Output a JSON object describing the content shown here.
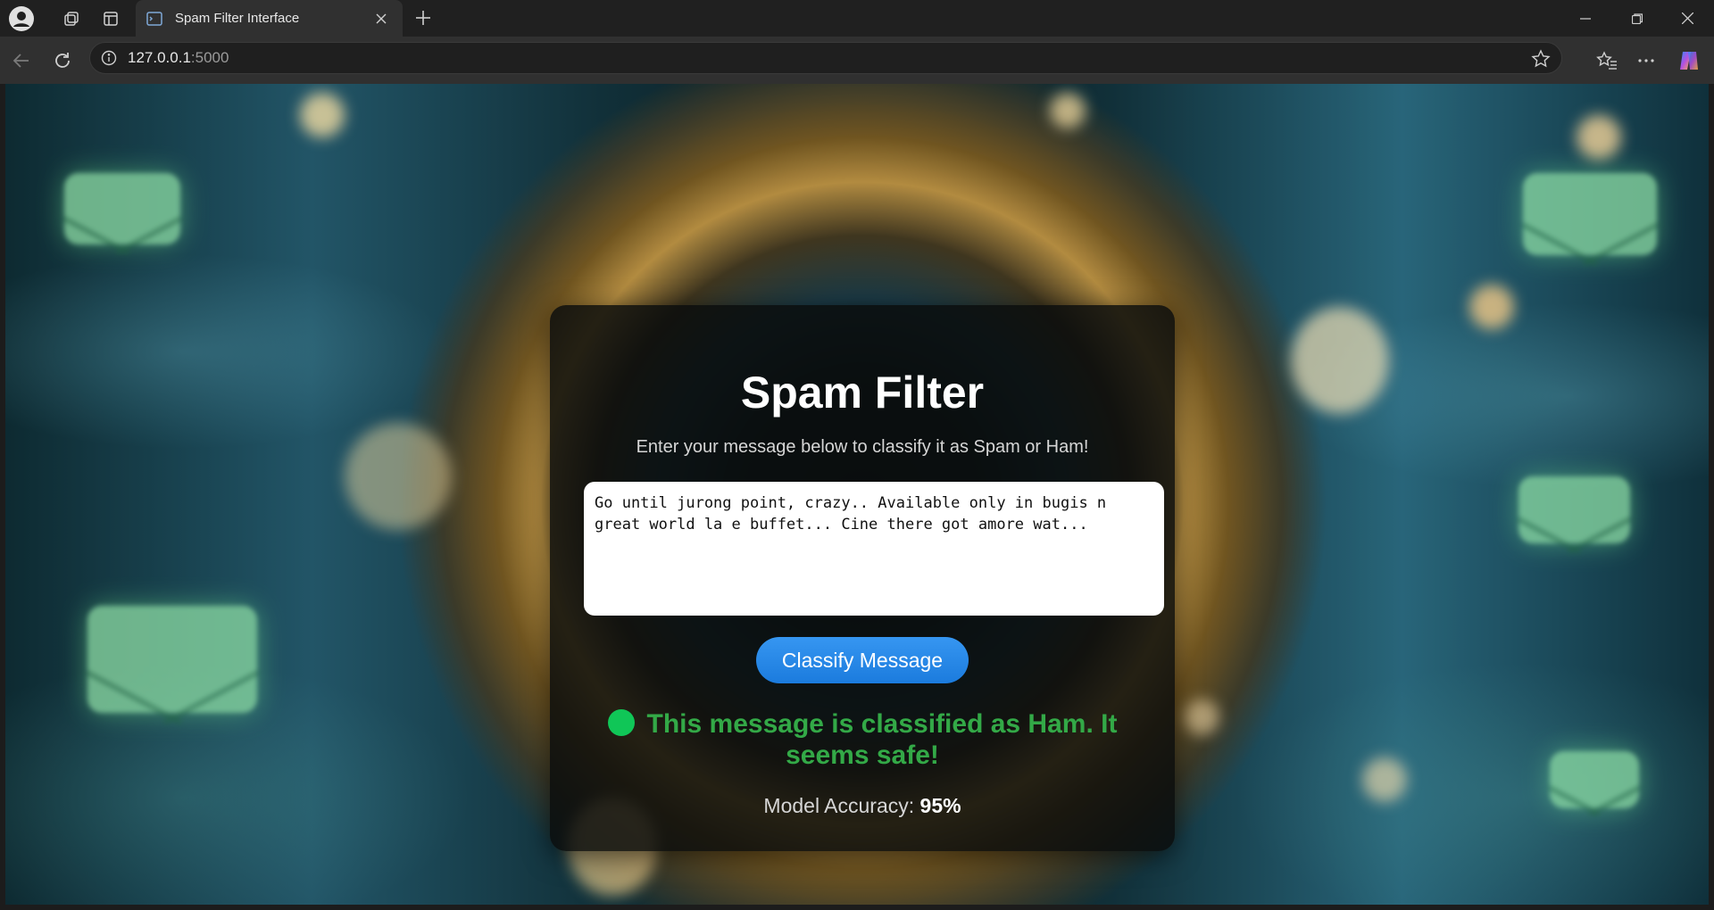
{
  "browser": {
    "tab_title": "Spam Filter Interface",
    "url_host": "127.0.0.1",
    "url_port": ":5000"
  },
  "page": {
    "title": "Spam Filter",
    "subtitle": "Enter your message below to classify it as Spam or Ham!",
    "message_value": "Go until jurong point, crazy.. Available only in bugis n great world la e buffet... Cine there got amore wat...",
    "classify_button_label": "Classify Message",
    "result_text": "This message is classified as Ham. It seems safe!",
    "result_color": "#37a74a",
    "accuracy_label": "Model Accuracy: ",
    "accuracy_value": "95%"
  }
}
